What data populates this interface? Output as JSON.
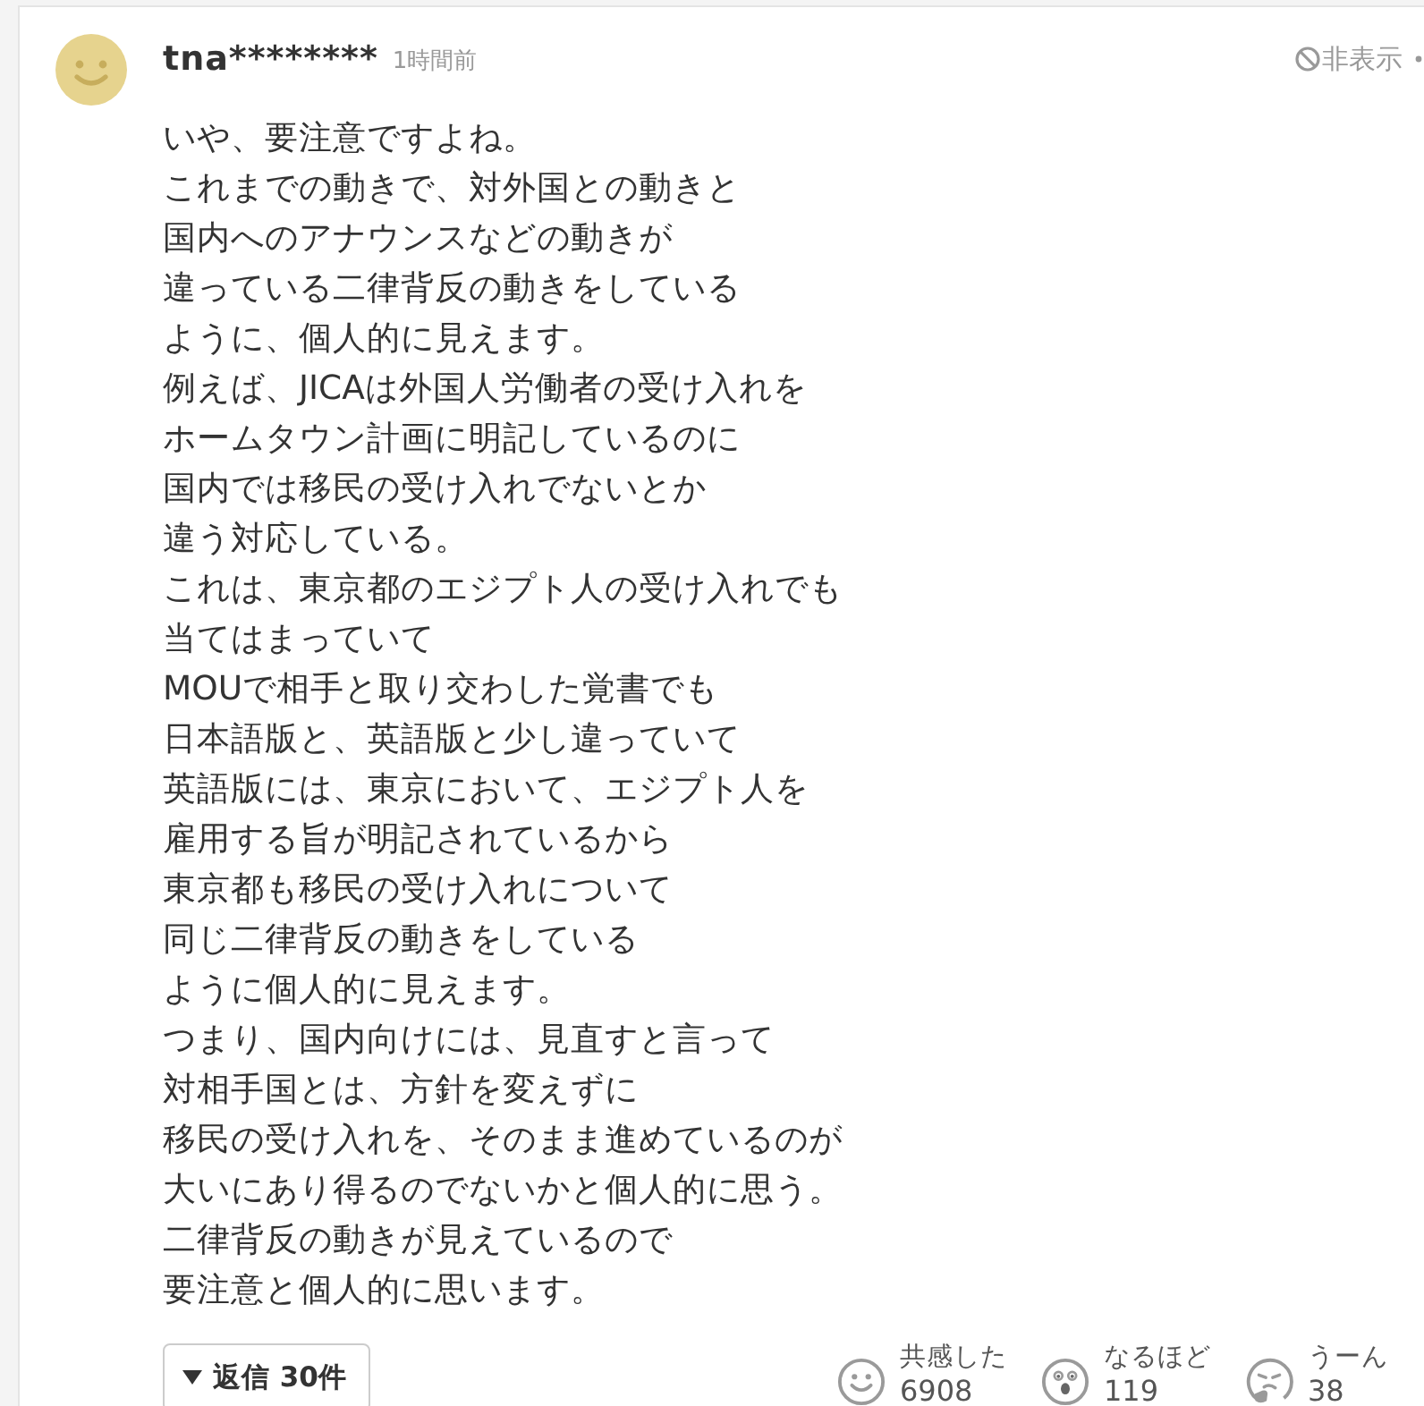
{
  "comment": {
    "username": "tna********",
    "time": "1時間前",
    "hide_label": "非表示",
    "body_lines": [
      "いや、要注意ですよね。",
      "これまでの動きで、対外国との動きと",
      "国内へのアナウンスなどの動きが",
      "違っている二律背反の動きをしている",
      "ように、個人的に見えます。",
      "例えば、JICAは外国人労働者の受け入れを",
      "ホームタウン計画に明記しているのに",
      "国内では移民の受け入れでないとか",
      "違う対応している。",
      "これは、東京都のエジプト人の受け入れでも",
      "当てはまっていて",
      "MOUで相手と取り交わした覚書でも",
      "日本語版と、英語版と少し違っていて",
      "英語版には、東京において、エジプト人を",
      "雇用する旨が明記されているから",
      "東京都も移民の受け入れについて",
      "同じ二律背反の動きをしている",
      "ように個人的に見えます。",
      "つまり、国内向けには、見直すと言って",
      "対相手国とは、方針を変えずに",
      "移民の受け入れを、そのまま進めているのが",
      "大いにあり得るのでないかと個人的に思う。",
      "二律背反の動きが見えているので",
      "要注意と個人的に思います。"
    ],
    "replies_label": "返信 30件",
    "reactions": [
      {
        "kind": "empathy",
        "label": "共感した",
        "count": "6908"
      },
      {
        "kind": "insight",
        "label": "なるほど",
        "count": "119"
      },
      {
        "kind": "hmm",
        "label": "うーん",
        "count": "38"
      }
    ]
  }
}
